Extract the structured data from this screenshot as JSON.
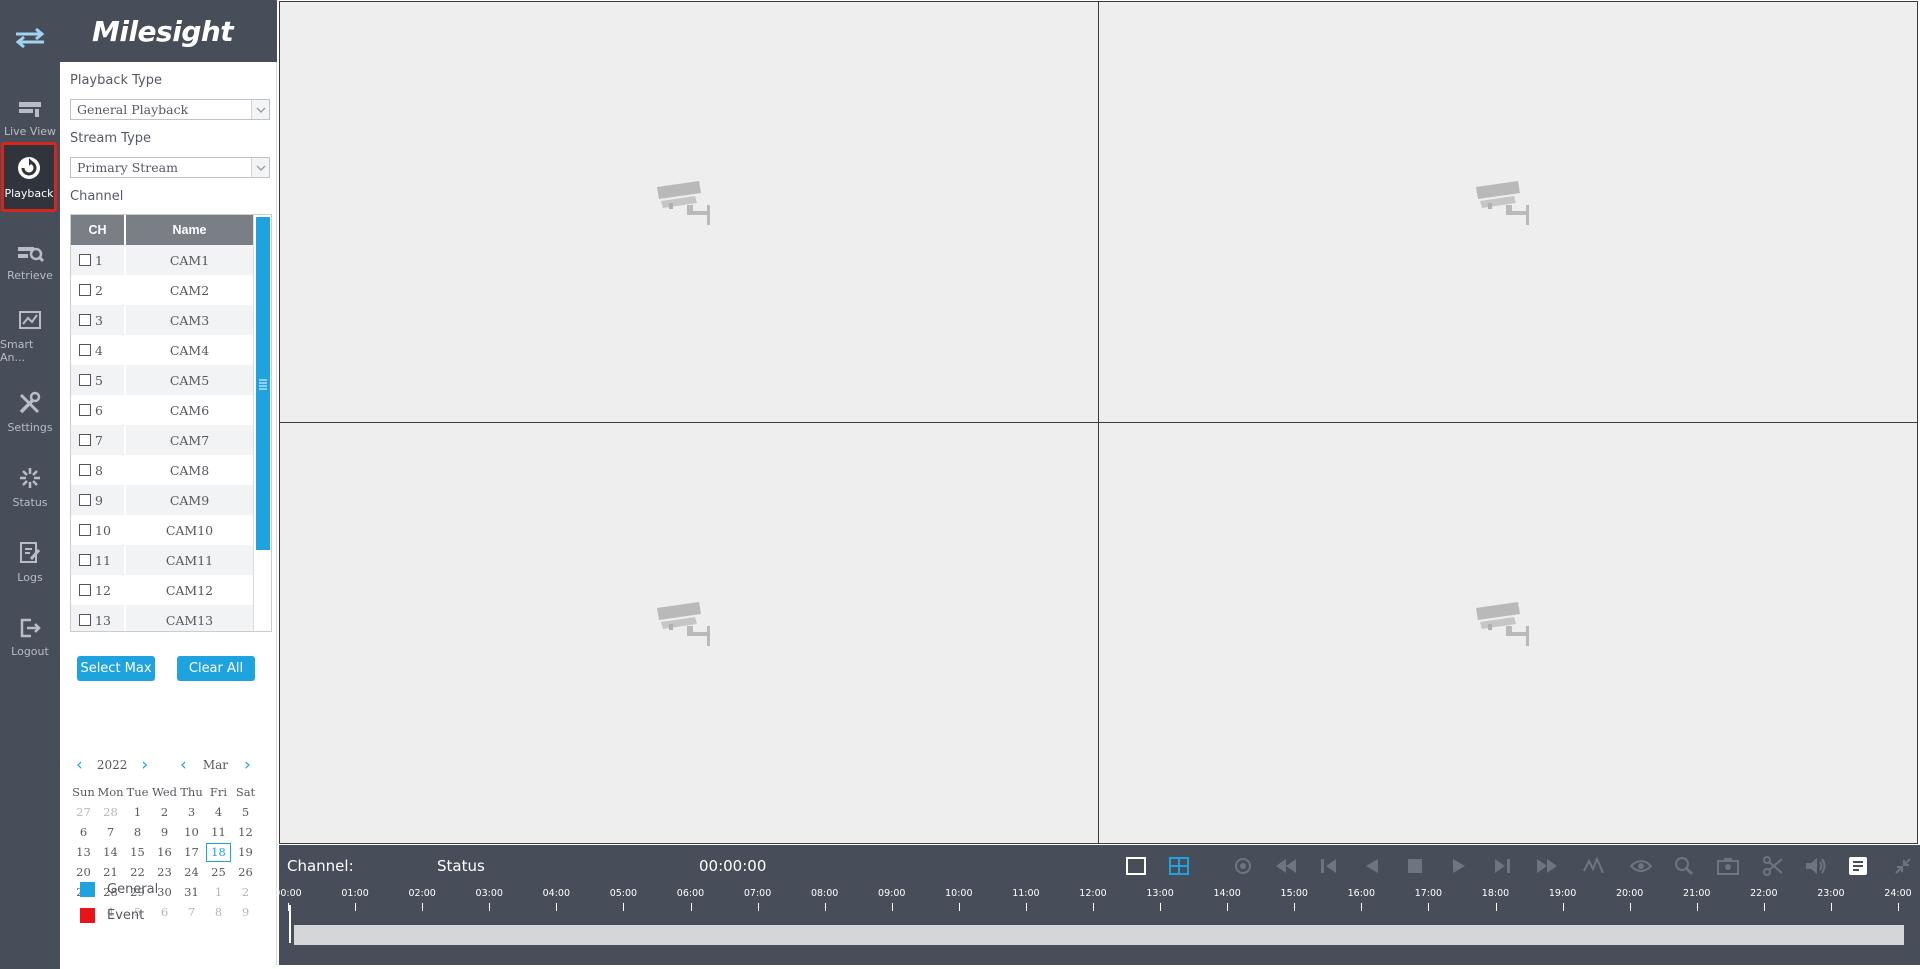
{
  "brand": {
    "logo_text": "Milesight"
  },
  "nav": {
    "items": [
      {
        "label": "Live View",
        "icon": "live-view-icon"
      },
      {
        "label": "Playback",
        "icon": "playback-icon",
        "active": true
      },
      {
        "label": "Retrieve",
        "icon": "retrieve-icon"
      },
      {
        "label": "Smart An...",
        "icon": "smart-analytics-icon"
      },
      {
        "label": "Settings",
        "icon": "settings-icon"
      },
      {
        "label": "Status",
        "icon": "status-icon"
      },
      {
        "label": "Logs",
        "icon": "logs-icon"
      },
      {
        "label": "Logout",
        "icon": "logout-icon"
      }
    ]
  },
  "panel": {
    "playback_type_label": "Playback Type",
    "playback_type_value": "General Playback",
    "stream_type_label": "Stream Type",
    "stream_type_value": "Primary Stream",
    "channel_label": "Channel",
    "table": {
      "headers": [
        "CH",
        "Name"
      ],
      "rows": [
        {
          "ch": "1",
          "name": "CAM1"
        },
        {
          "ch": "2",
          "name": "CAM2"
        },
        {
          "ch": "3",
          "name": "CAM3"
        },
        {
          "ch": "4",
          "name": "CAM4"
        },
        {
          "ch": "5",
          "name": "CAM5"
        },
        {
          "ch": "6",
          "name": "CAM6"
        },
        {
          "ch": "7",
          "name": "CAM7"
        },
        {
          "ch": "8",
          "name": "CAM8"
        },
        {
          "ch": "9",
          "name": "CAM9"
        },
        {
          "ch": "10",
          "name": "CAM10"
        },
        {
          "ch": "11",
          "name": "CAM11"
        },
        {
          "ch": "12",
          "name": "CAM12"
        },
        {
          "ch": "13",
          "name": "CAM13"
        }
      ]
    },
    "select_max_label": "Select Max",
    "clear_all_label": "Clear All",
    "calendar": {
      "year": "2022",
      "month": "Mar",
      "weekdays": [
        "Sun",
        "Mon",
        "Tue",
        "Wed",
        "Thu",
        "Fri",
        "Sat"
      ],
      "weeks": [
        [
          "27",
          "28",
          "1",
          "2",
          "3",
          "4",
          "5"
        ],
        [
          "6",
          "7",
          "8",
          "9",
          "10",
          "11",
          "12"
        ],
        [
          "13",
          "14",
          "15",
          "16",
          "17",
          "18",
          "19"
        ],
        [
          "20",
          "21",
          "22",
          "23",
          "24",
          "25",
          "26"
        ],
        [
          "27",
          "28",
          "29",
          "30",
          "31",
          "1",
          "2"
        ],
        [
          "3",
          "4",
          "5",
          "6",
          "7",
          "8",
          "9"
        ]
      ],
      "selected_day": "18"
    },
    "legend": [
      {
        "label": "General",
        "color": "#1fa3df"
      },
      {
        "label": "Event",
        "color": "#e8141a"
      }
    ]
  },
  "bottom": {
    "channel_label": "Channel:",
    "status_label": "Status",
    "time": "00:00:00",
    "timeline_labels": [
      "00:00",
      "01:00",
      "02:00",
      "03:00",
      "04:00",
      "05:00",
      "06:00",
      "07:00",
      "08:00",
      "09:00",
      "10:00",
      "11:00",
      "12:00",
      "13:00",
      "14:00",
      "15:00",
      "16:00",
      "17:00",
      "18:00",
      "19:00",
      "20:00",
      "21:00",
      "22:00",
      "23:00",
      "24:00"
    ],
    "controls": [
      "single-screen-icon",
      "quad-screen-icon",
      "snapshot-icon",
      "rewind-icon",
      "step-back-icon",
      "play-reverse-icon",
      "stop-icon",
      "play-icon",
      "step-forward-icon",
      "fast-forward-icon",
      "event-search-icon",
      "eye-icon",
      "zoom-icon",
      "capture-icon",
      "clip-icon",
      "volume-icon",
      "tag-icon",
      "fullscreen-icon"
    ]
  }
}
